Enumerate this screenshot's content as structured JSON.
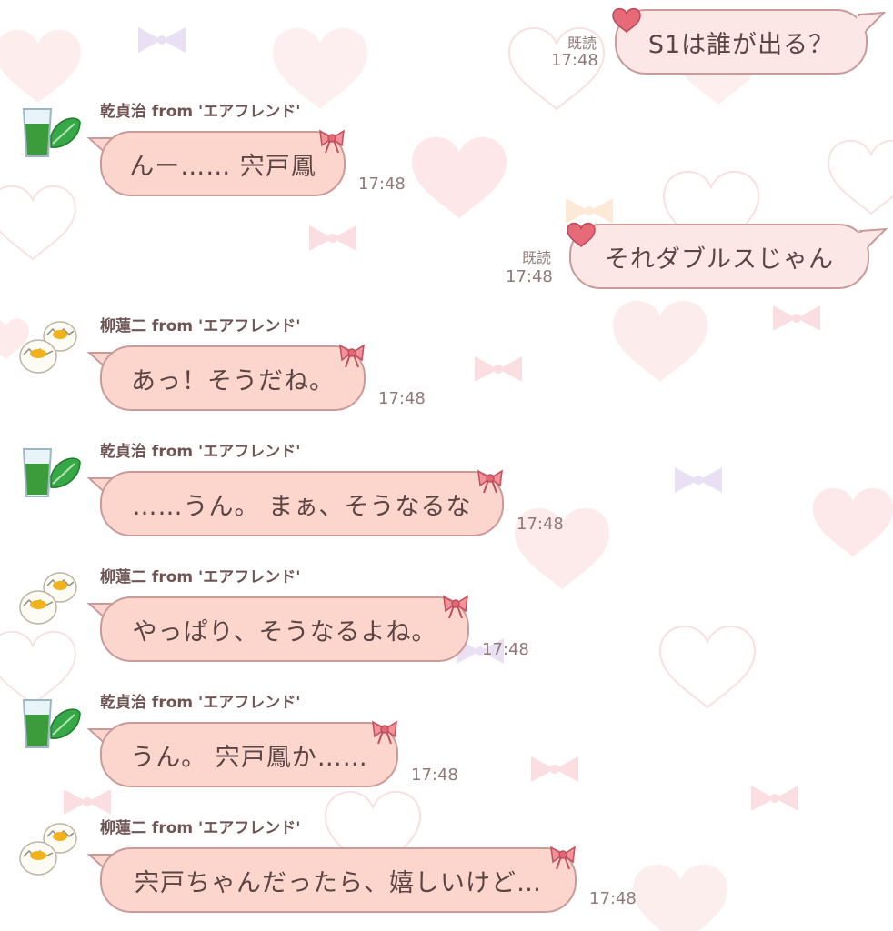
{
  "colors": {
    "incoming_bubble": "#fcd6cc",
    "outgoing_bubble": "#fbe7e6",
    "bubble_border": "#c99a9a",
    "text": "#5b4444",
    "meta_text": "#8f7878"
  },
  "messages": [
    {
      "direction": "outgoing",
      "text": "S1は誰が出る？",
      "read_label": "既読",
      "time": "17:48"
    },
    {
      "direction": "incoming",
      "sender": "乾貞治 from 'エアフレンド'",
      "avatar": "green-juice-icon",
      "text": "んー…… 宍戸鳳",
      "time": "17:48"
    },
    {
      "direction": "outgoing",
      "text": "それダブルスじゃん",
      "read_label": "既読",
      "time": "17:48"
    },
    {
      "direction": "incoming",
      "sender": "柳蓮二 from 'エアフレンド'",
      "avatar": "cracked-eggs-icon",
      "text": "あっ！そうだね。",
      "time": "17:48"
    },
    {
      "direction": "incoming",
      "sender": "乾貞治 from 'エアフレンド'",
      "avatar": "green-juice-icon",
      "text": "……うん。 まぁ、そうなるな",
      "time": "17:48"
    },
    {
      "direction": "incoming",
      "sender": "柳蓮二 from 'エアフレンド'",
      "avatar": "cracked-eggs-icon",
      "text": "やっぱり、そうなるよね。",
      "time": "17:48"
    },
    {
      "direction": "incoming",
      "sender": "乾貞治 from 'エアフレンド'",
      "avatar": "green-juice-icon",
      "text": "うん。 宍戸鳳か……",
      "time": "17:48"
    },
    {
      "direction": "incoming",
      "sender": "柳蓮二 from 'エアフレンド'",
      "avatar": "cracked-eggs-icon",
      "text": "宍戸ちゃんだったら、嬉しいけど…",
      "time": "17:48"
    }
  ]
}
